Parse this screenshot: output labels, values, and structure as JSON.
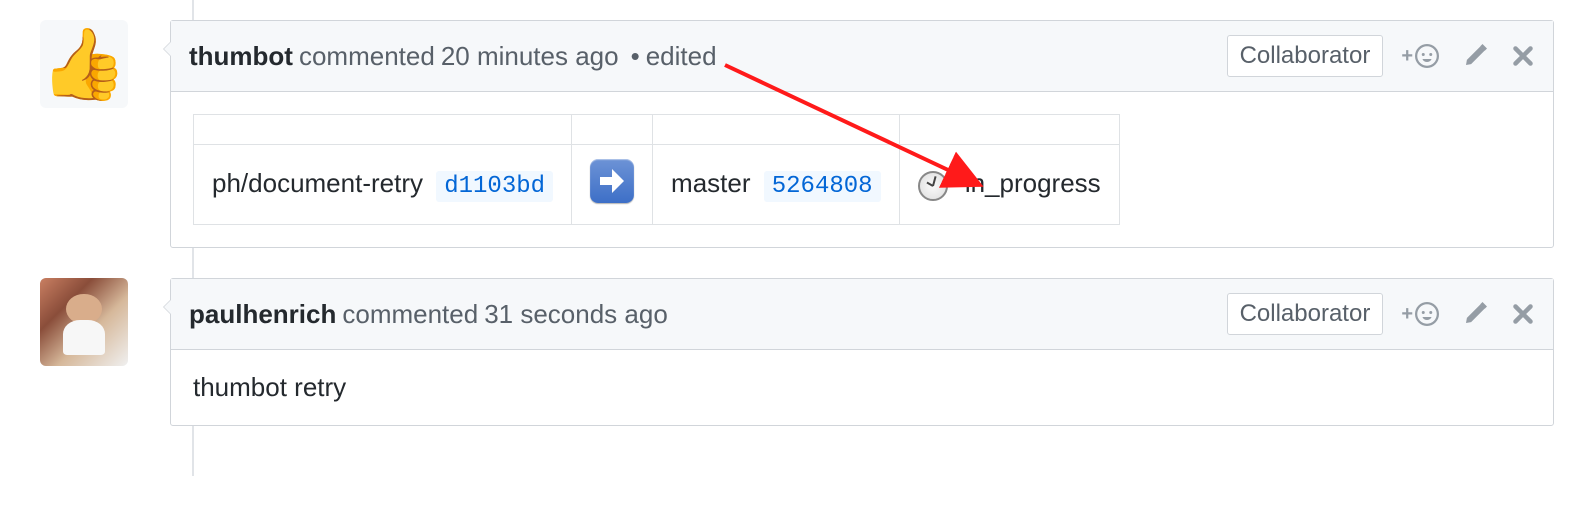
{
  "comments": [
    {
      "author": "thumbot",
      "action": "commented",
      "time": "20 minutes ago",
      "edited": "edited",
      "badge": "Collaborator",
      "avatar": "thumbsup",
      "table": {
        "source_branch": "ph/document-retry",
        "source_sha": "d1103bd",
        "target_branch": "master",
        "target_sha": "5264808",
        "status": "in_progress"
      }
    },
    {
      "author": "paulhenrich",
      "action": "commented",
      "time": "31 seconds ago",
      "badge": "Collaborator",
      "avatar": "photo",
      "body": "thumbot retry"
    }
  ]
}
